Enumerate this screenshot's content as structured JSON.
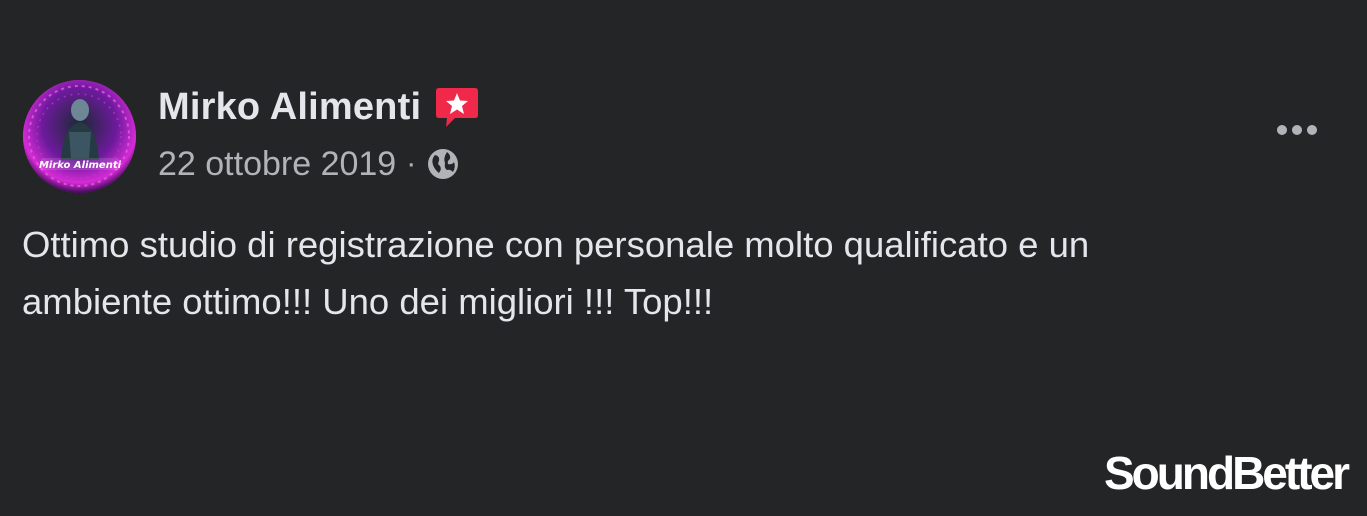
{
  "post": {
    "author": {
      "name": "Mirko Alimenti",
      "badge_icon": "star-speech-bubble-icon",
      "badge_color": "#f02849",
      "avatar_icon": "profile-photo-avatar",
      "avatar_text": "Mirko Alimenti"
    },
    "date": "22 ottobre 2019",
    "separator": "·",
    "privacy_icon": "globe-icon",
    "more_icon": "more-options-icon",
    "body": "Ottimo studio di registrazione con personale molto qualificato e un\nambiente ottimo!!! Uno dei migliori !!! Top!!!"
  },
  "watermark": {
    "text": "SoundBetter"
  },
  "colors": {
    "background": "#242526",
    "primary_text": "#e4e6eb",
    "secondary_text": "#b0b3b8",
    "logo": "#ffffff"
  }
}
